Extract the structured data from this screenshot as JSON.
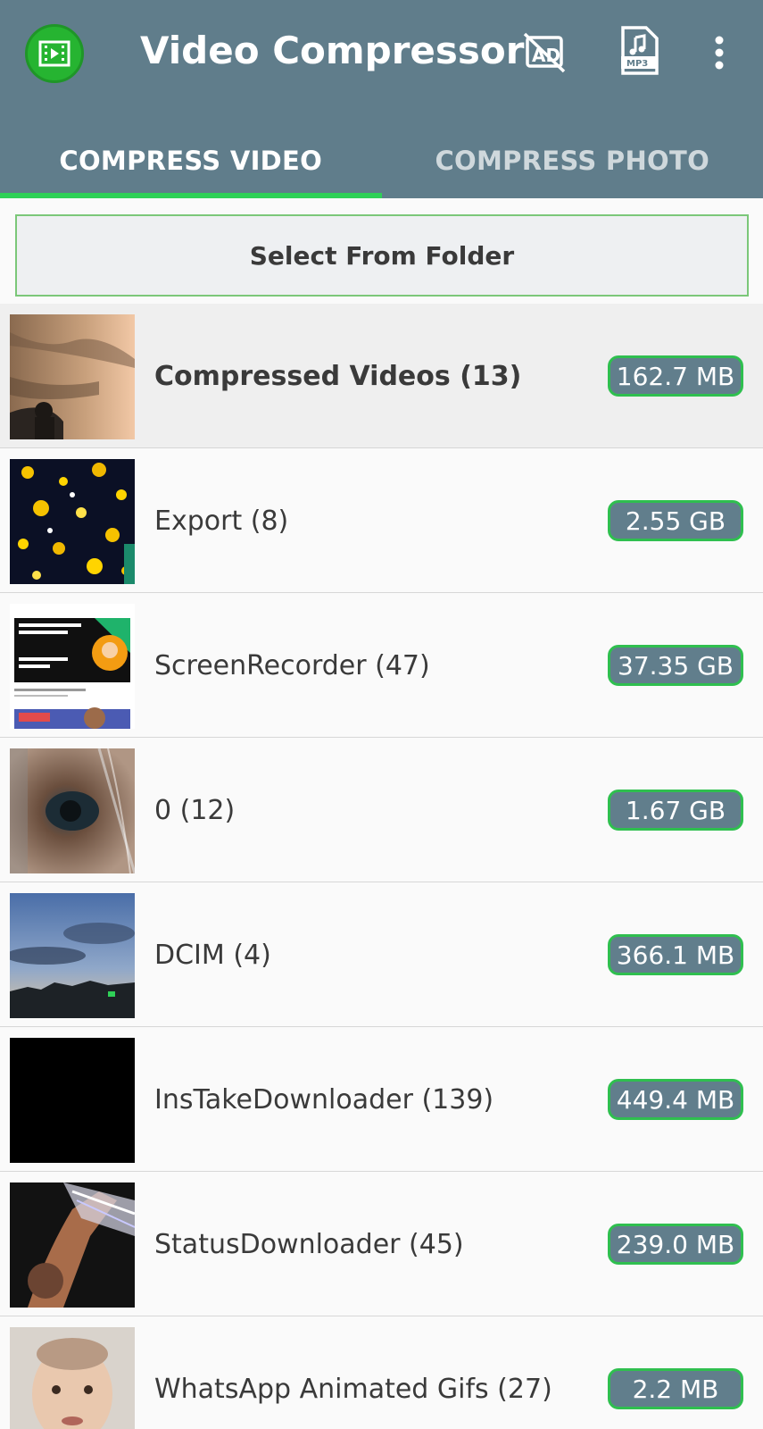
{
  "app": {
    "title": "Video Compressor",
    "icons": [
      "app-logo-icon",
      "ad-free-icon",
      "mp3-icon",
      "more-vert-icon"
    ],
    "colors": {
      "appbar": "#607d8b",
      "accent": "#2fd057",
      "badge": "#617e8c"
    }
  },
  "tabs": [
    {
      "label": "COMPRESS VIDEO",
      "active": true
    },
    {
      "label": "COMPRESS PHOTO",
      "active": false
    }
  ],
  "select_folder_label": "Select From Folder",
  "folders": [
    {
      "name": "Compressed Videos (13)",
      "size": "162.7 MB"
    },
    {
      "name": "Export (8)",
      "size": "2.55 GB"
    },
    {
      "name": "ScreenRecorder (47)",
      "size": "37.35 GB"
    },
    {
      "name": "0 (12)",
      "size": "1.67 GB"
    },
    {
      "name": "DCIM (4)",
      "size": "366.1 MB"
    },
    {
      "name": "InsTakeDownloader (139)",
      "size": "449.4 MB"
    },
    {
      "name": "StatusDownloader (45)",
      "size": "239.0 MB"
    },
    {
      "name": "WhatsApp Animated Gifs (27)",
      "size": "2.2 MB"
    }
  ]
}
